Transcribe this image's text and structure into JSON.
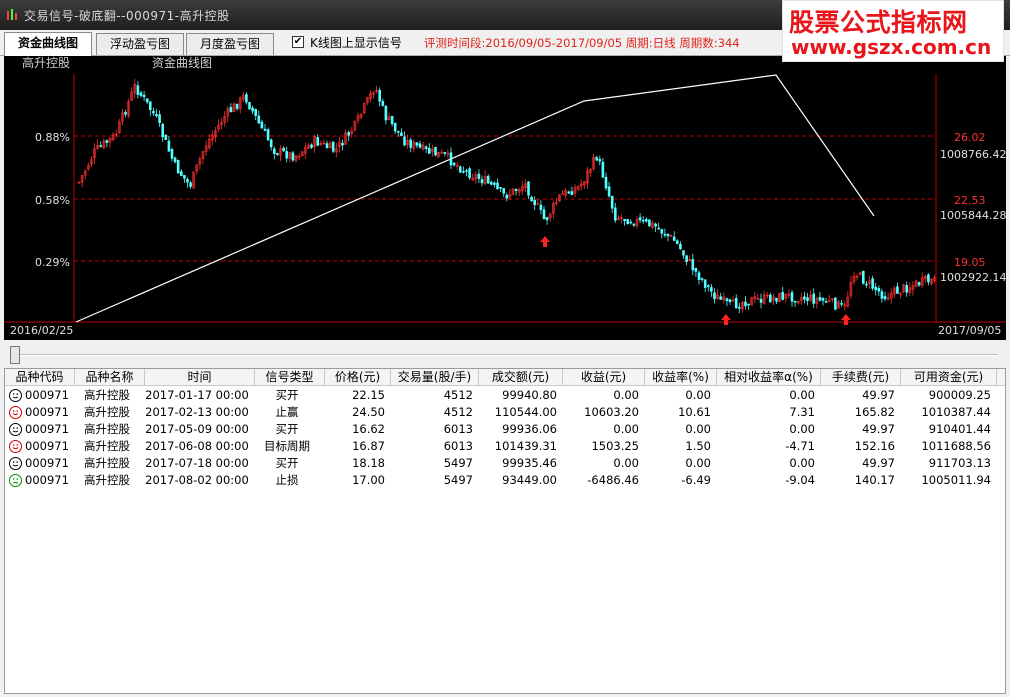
{
  "window": {
    "title": "交易信号-破底翻--000971-高升控股"
  },
  "watermark": {
    "line1": "股票公式指标网",
    "line2": "www.gszx.com.cn"
  },
  "tabs": [
    {
      "label": "资金曲线图",
      "active": true
    },
    {
      "label": "浮动盈亏图",
      "active": false
    },
    {
      "label": "月度盈亏图",
      "active": false
    }
  ],
  "options": {
    "show_signal_checked": true,
    "show_signal_label": "K线图上显示信号"
  },
  "eval": {
    "text": "评测时间段:2016/09/05-2017/09/05  周期:日线  周期数:344"
  },
  "chart": {
    "stock_label": "高升控股",
    "curve_label": "资金曲线图",
    "left_ticks": [
      "0.88%",
      "0.58%",
      "0.29%"
    ],
    "right_price_ticks": [
      "26.02",
      "22.53",
      "19.05"
    ],
    "right_fund_ticks": [
      "1008766.42",
      "1005844.28",
      "1002922.14"
    ],
    "start_date": "2016/02/25",
    "end_date": "2017/09/05",
    "colors": {
      "up": "#ff3030",
      "down": "#54ffff",
      "grid": "#c00000",
      "axis": "#c00000",
      "curve": "#ffffff",
      "signal": "#ff2020"
    }
  },
  "chart_data": {
    "type": "candlestick",
    "price_levels": [
      26.02,
      22.53,
      19.05
    ],
    "fund_levels": [
      1008766.42,
      1005844.28,
      1002922.14
    ],
    "fund_curve_x": [
      "start",
      "mid",
      "peak",
      "end"
    ],
    "buy_signal_count": 3
  },
  "table": {
    "headers": [
      "品种代码",
      "品种名称",
      "时间",
      "信号类型",
      "价格(元)",
      "交易量(股/手)",
      "成交额(元)",
      "收益(元)",
      "收益率(%)",
      "相对收益率α(%)",
      "手续费(元)",
      "可用资金(元)"
    ],
    "rows": [
      {
        "face": "neutral",
        "code": "000971",
        "name": "高升控股",
        "time": "2017-01-17 00:00",
        "type": "买开",
        "price": "22.15",
        "qty": "4512",
        "amount": "99940.80",
        "profit": "0.00",
        "rate": "0.00",
        "alpha": "0.00",
        "fee": "49.97",
        "cash": "900009.25"
      },
      {
        "face": "happy",
        "code": "000971",
        "name": "高升控股",
        "time": "2017-02-13 00:00",
        "type": "止赢",
        "price": "24.50",
        "qty": "4512",
        "amount": "110544.00",
        "profit": "10603.20",
        "rate": "10.61",
        "alpha": "7.31",
        "fee": "165.82",
        "cash": "1010387.44"
      },
      {
        "face": "neutral",
        "code": "000971",
        "name": "高升控股",
        "time": "2017-05-09 00:00",
        "type": "买开",
        "price": "16.62",
        "qty": "6013",
        "amount": "99936.06",
        "profit": "0.00",
        "rate": "0.00",
        "alpha": "0.00",
        "fee": "49.97",
        "cash": "910401.44"
      },
      {
        "face": "happy",
        "code": "000971",
        "name": "高升控股",
        "time": "2017-06-08 00:00",
        "type": "目标周期",
        "price": "16.87",
        "qty": "6013",
        "amount": "101439.31",
        "profit": "1503.25",
        "rate": "1.50",
        "alpha": "-4.71",
        "fee": "152.16",
        "cash": "1011688.56"
      },
      {
        "face": "neutral",
        "code": "000971",
        "name": "高升控股",
        "time": "2017-07-18 00:00",
        "type": "买开",
        "price": "18.18",
        "qty": "5497",
        "amount": "99935.46",
        "profit": "0.00",
        "rate": "0.00",
        "alpha": "0.00",
        "fee": "49.97",
        "cash": "911703.13"
      },
      {
        "face": "sad",
        "code": "000971",
        "name": "高升控股",
        "time": "2017-08-02 00:00",
        "type": "止损",
        "price": "17.00",
        "qty": "5497",
        "amount": "93449.00",
        "profit": "-6486.46",
        "rate": "-6.49",
        "alpha": "-9.04",
        "fee": "140.17",
        "cash": "1005011.94"
      }
    ]
  }
}
